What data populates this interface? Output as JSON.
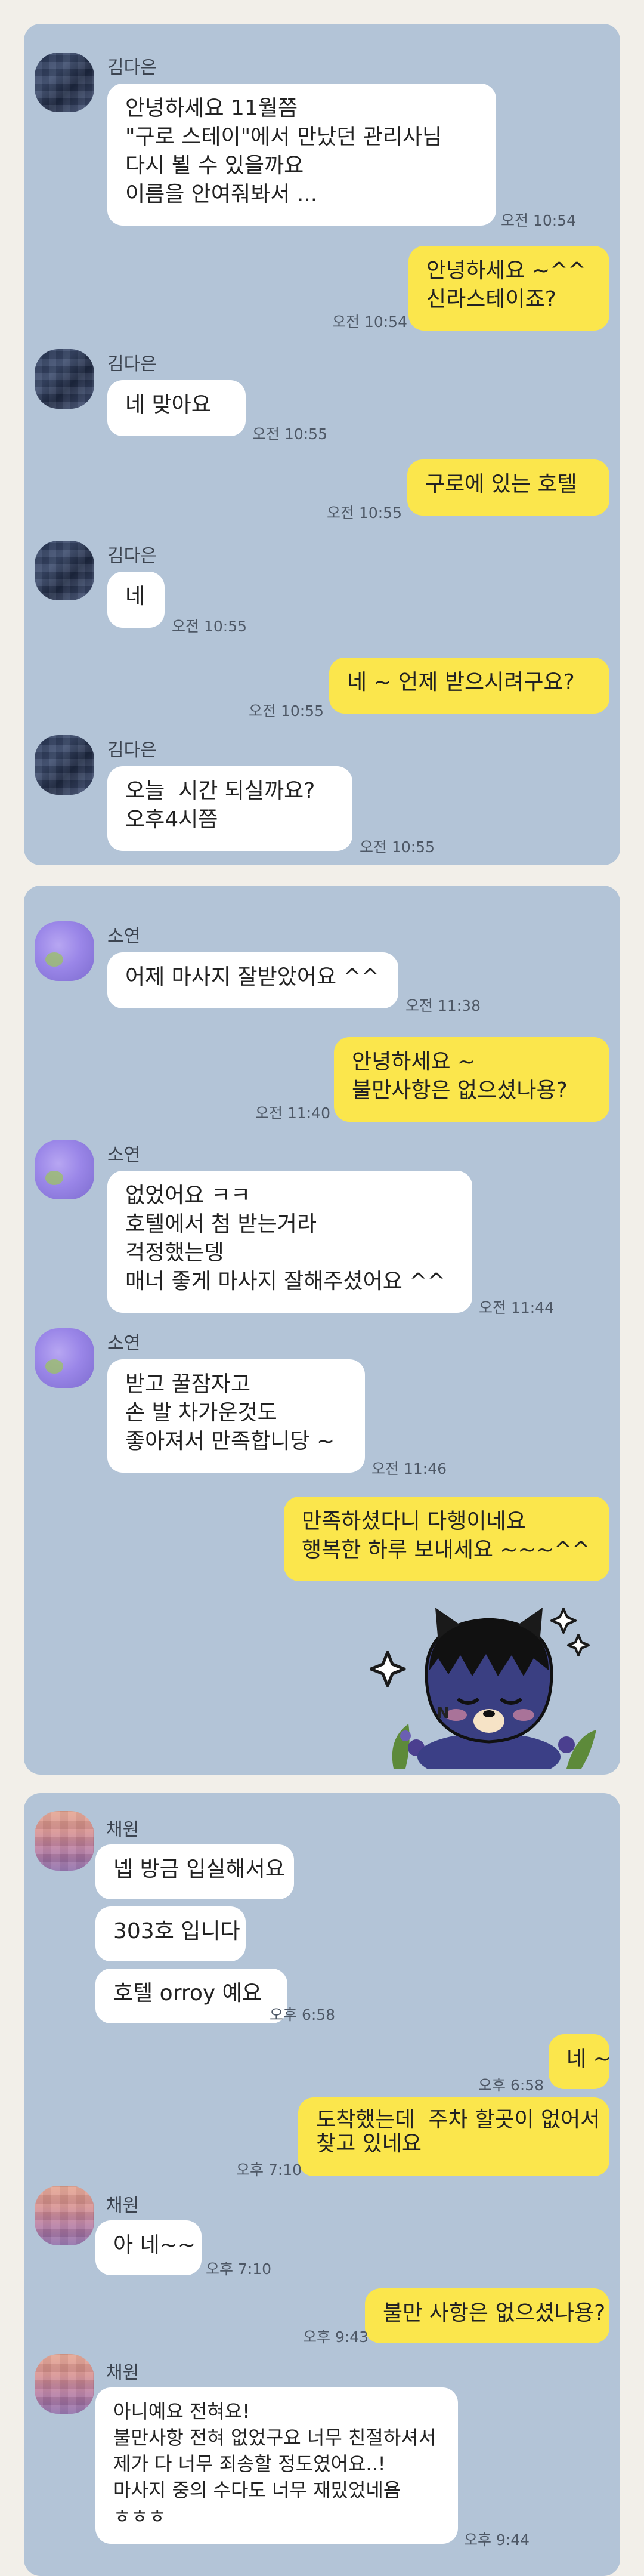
{
  "panel1": {
    "sender": "김다은",
    "messages": [
      {
        "text": "안녕하세요 11월쯤\n\"구로 스테이\"에서 만났던 관리사님\n다시 뵐 수 있을까요\n이름을 안여줘봐서 ...",
        "time": "오전 10:54"
      },
      {
        "text": "안녕하세요 ~^^\n신라스테이죠?",
        "time": "오전 10:54"
      },
      {
        "text": "네 맞아요",
        "time": "오전 10:55"
      },
      {
        "text": "구로에 있는 호텔",
        "time": "오전 10:55"
      },
      {
        "text": "네",
        "time": "오전 10:55"
      },
      {
        "text": "네 ~ 언제 받으시려구요?",
        "time": "오전 10:55"
      },
      {
        "text": "오늘  시간 되실까요?\n오후4시쯤",
        "time": "오전 10:55"
      }
    ]
  },
  "panel2": {
    "sender": "소연",
    "messages": [
      {
        "text": "어제 마사지 잘받았어요 ^^",
        "time": "오전 11:38"
      },
      {
        "text": "안녕하세요 ~\n불만사항은 없으셨나용?",
        "time": "오전 11:40"
      },
      {
        "text": "없었어요 ㅋㅋ\n호텔에서 첨 받는거라\n걱정했는뎅\n매너 좋게 마사지 잘해주셨어요 ^^",
        "time": "오전 11:44"
      },
      {
        "text": "받고 꿀잠자고\n손 발 차가운것도\n좋아져서 만족합니당 ~",
        "time": "오전 11:46"
      },
      {
        "text": "만족하셨다니 다행이네요\n행복한 하루 보내세요 ~~~^^"
      }
    ],
    "sticker": "sleepy-cat-sticker"
  },
  "panel3": {
    "sender": "채원",
    "messages": [
      {
        "text": "넵 방금 입실해서요"
      },
      {
        "text": "303호 입니다"
      },
      {
        "text": "호텔 orroy 예요",
        "time": "오후 6:58"
      },
      {
        "text": "네 ~",
        "time": "오후 6:58"
      },
      {
        "text": "도착했는데  주차 할곳이 없어서\n찾고 있네요",
        "time": "오후 7:10"
      },
      {
        "text": "아 네~~",
        "time": "오후 7:10"
      },
      {
        "text": "불만 사항은 없으셨나용?",
        "time": "오후 9:43"
      },
      {
        "text": "아니예요 전혀요!\n불만사항 전혀 없었구요 너무 친절하셔서\n제가 다 너무 죄송할 정도였어요..!\n마사지 중의 수다도 너무 재밌었네욤\nㅎㅎㅎ",
        "time": "오후 9:44"
      }
    ]
  }
}
